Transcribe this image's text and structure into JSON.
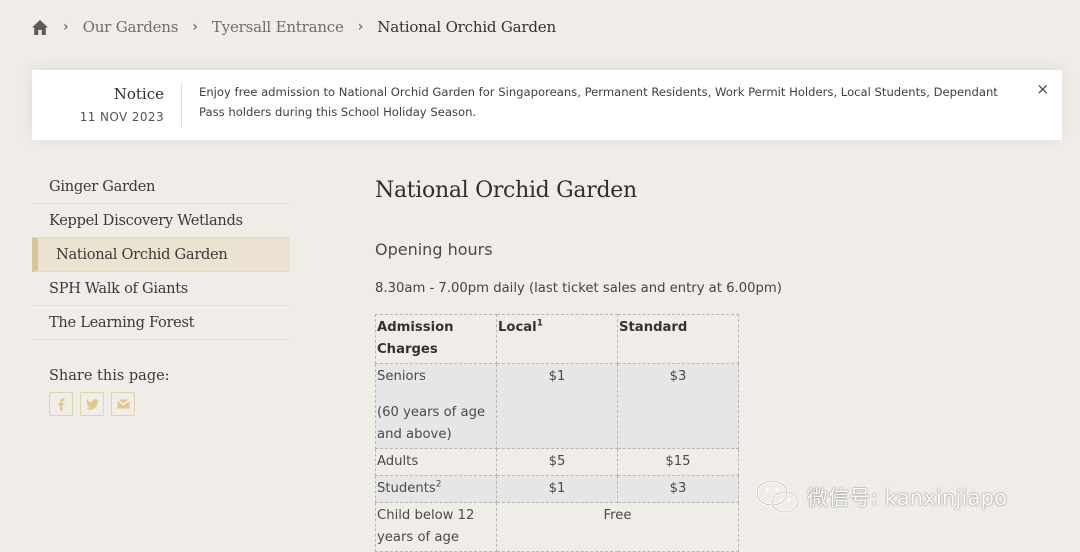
{
  "breadcrumb": {
    "items": [
      "Our Gardens",
      "Tyersall Entrance"
    ],
    "current": "National Orchid Garden",
    "separator": "›"
  },
  "notice": {
    "title": "Notice",
    "date": "11 NOV 2023",
    "text": "Enjoy free admission to National Orchid Garden for Singaporeans, Permanent Residents, Work Permit Holders, Local Students, Dependant Pass holders during this School Holiday Season.",
    "close": "×"
  },
  "sidebar": {
    "items": [
      {
        "label": "Ginger Garden"
      },
      {
        "label": "Keppel Discovery Wetlands"
      },
      {
        "label": "National Orchid Garden",
        "active": true
      },
      {
        "label": "SPH Walk of Giants"
      },
      {
        "label": "The Learning Forest"
      }
    ],
    "share_label": "Share this page:",
    "share_icons": [
      "facebook-icon",
      "twitter-icon",
      "email-icon"
    ]
  },
  "main": {
    "title": "National Orchid Garden",
    "hours_heading": "Opening hours",
    "hours_text": "8.30am - 7.00pm daily (last ticket sales and entry at 6.00pm)",
    "table": {
      "headers": [
        "Admission Charges",
        "Local",
        "Standard"
      ],
      "header_sup": "1",
      "rows": [
        {
          "label": "Seniors",
          "note": "(60 years of age and above)",
          "local": "$1",
          "standard": "$3"
        },
        {
          "label": "Adults",
          "local": "$5",
          "standard": "$15"
        },
        {
          "label": "Students",
          "sup": "2",
          "local": "$1",
          "standard": "$3"
        },
        {
          "label": "Child below 12 years of age",
          "merged": "Free"
        }
      ]
    }
  },
  "watermark": {
    "text": "微信号: kanxinjiapo"
  },
  "colors": {
    "background": "#f0ede8",
    "active_bg": "#ebe2d1",
    "active_bar": "#d9c59a",
    "share_icon": "#e0c98c"
  }
}
